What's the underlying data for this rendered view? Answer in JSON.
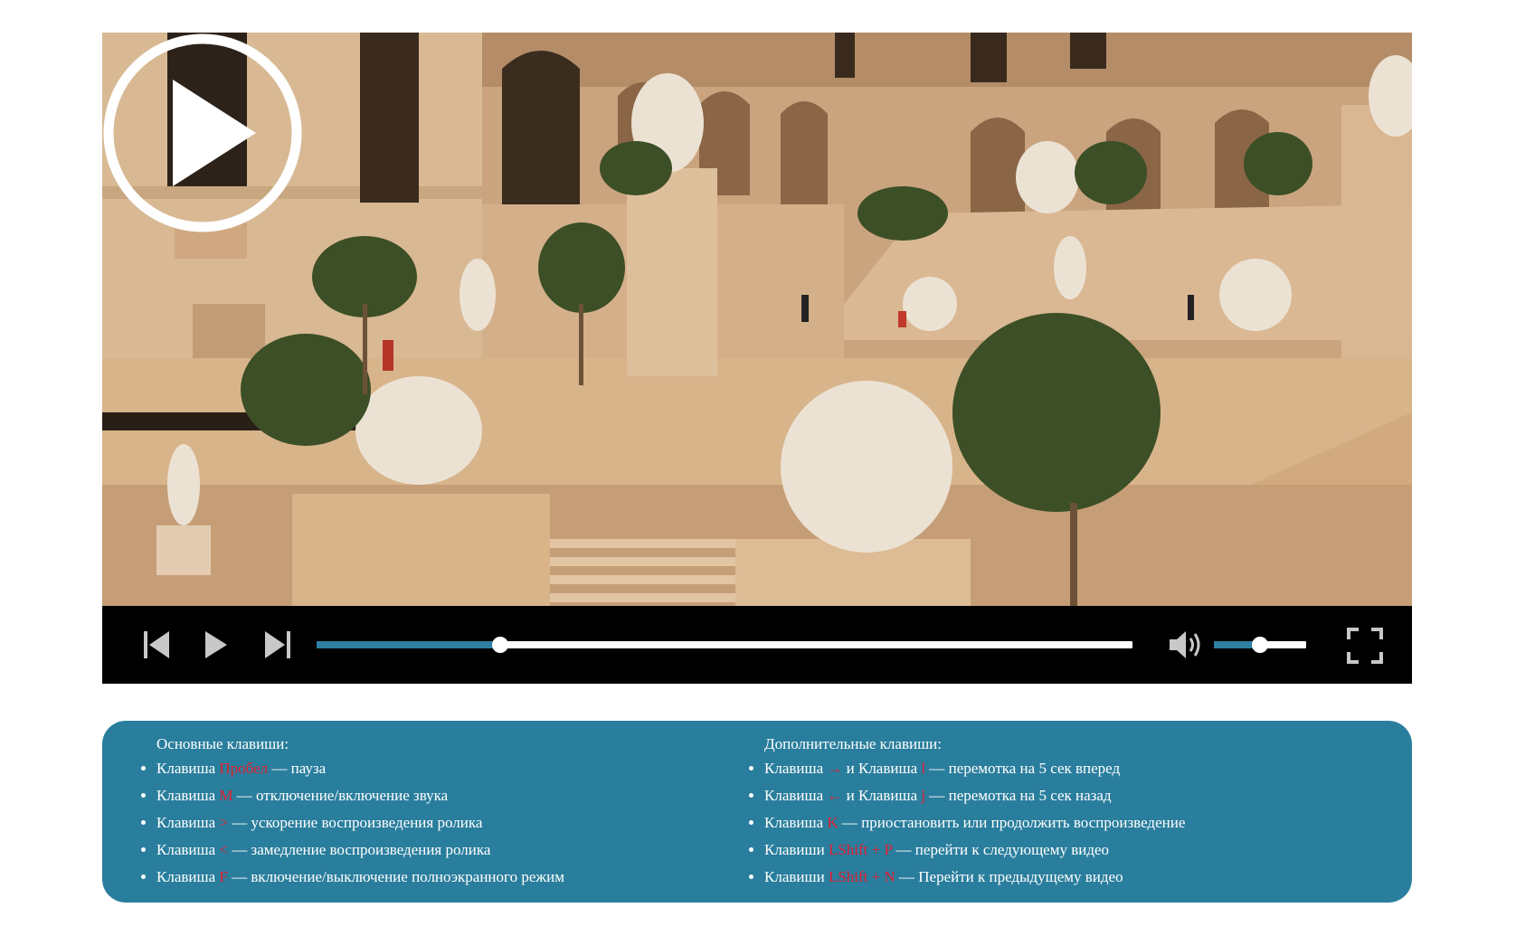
{
  "colors": {
    "accent": "#2e7fa1",
    "panel_background": "#2a7e9d",
    "key_highlight": "#e0202f",
    "controls_background": "#000000"
  },
  "player": {
    "poster_icon": "play-circle-icon",
    "controls": {
      "prev_icon": "skip-previous-icon",
      "play_icon": "play-icon",
      "next_icon": "skip-next-icon",
      "volume_icon": "volume-icon",
      "fullscreen_icon": "fullscreen-icon",
      "progress_fraction": 0.225,
      "volume_fraction": 0.5
    }
  },
  "help": {
    "left": {
      "title": "Основные клавиши:",
      "items": [
        {
          "prefix": "Клавиша ",
          "key": "Пробел",
          "desc": " — пауза"
        },
        {
          "prefix": "Клавиша ",
          "key": "M",
          "desc": " — отключение/включение звука"
        },
        {
          "prefix": "Клавиша ",
          "key": ">",
          "desc": " — ускорение воспроизведения ролика"
        },
        {
          "prefix": "Клавиша ",
          "key": "<",
          "desc": " — замедление воспроизведения ролика"
        },
        {
          "prefix": "Клавиша ",
          "key": "F",
          "desc": " — включение/выключение полноэкранного режим"
        }
      ]
    },
    "right": {
      "title": "Дополнительные клавиши:",
      "items": [
        {
          "prefix": "Клавиша ",
          "key": "→",
          "mid": " и Клавиша ",
          "key2": "l",
          "desc": " — перемотка на 5 сек вперед"
        },
        {
          "prefix": "Клавиша ",
          "key": "←",
          "mid": " и Клавиша ",
          "key2": "j",
          "desc": " — перемотка на 5 сек назад"
        },
        {
          "prefix": "Клавиша ",
          "key": "K",
          "desc": " — приостановить или продолжить воспроизведение"
        },
        {
          "prefix": "Клавиши ",
          "key": "LShift + P",
          "desc": " — перейти к следующему видео"
        },
        {
          "prefix": "Клавиши ",
          "key": "LShift + N",
          "desc": " — Перейти к предыдущему видео"
        }
      ]
    }
  }
}
